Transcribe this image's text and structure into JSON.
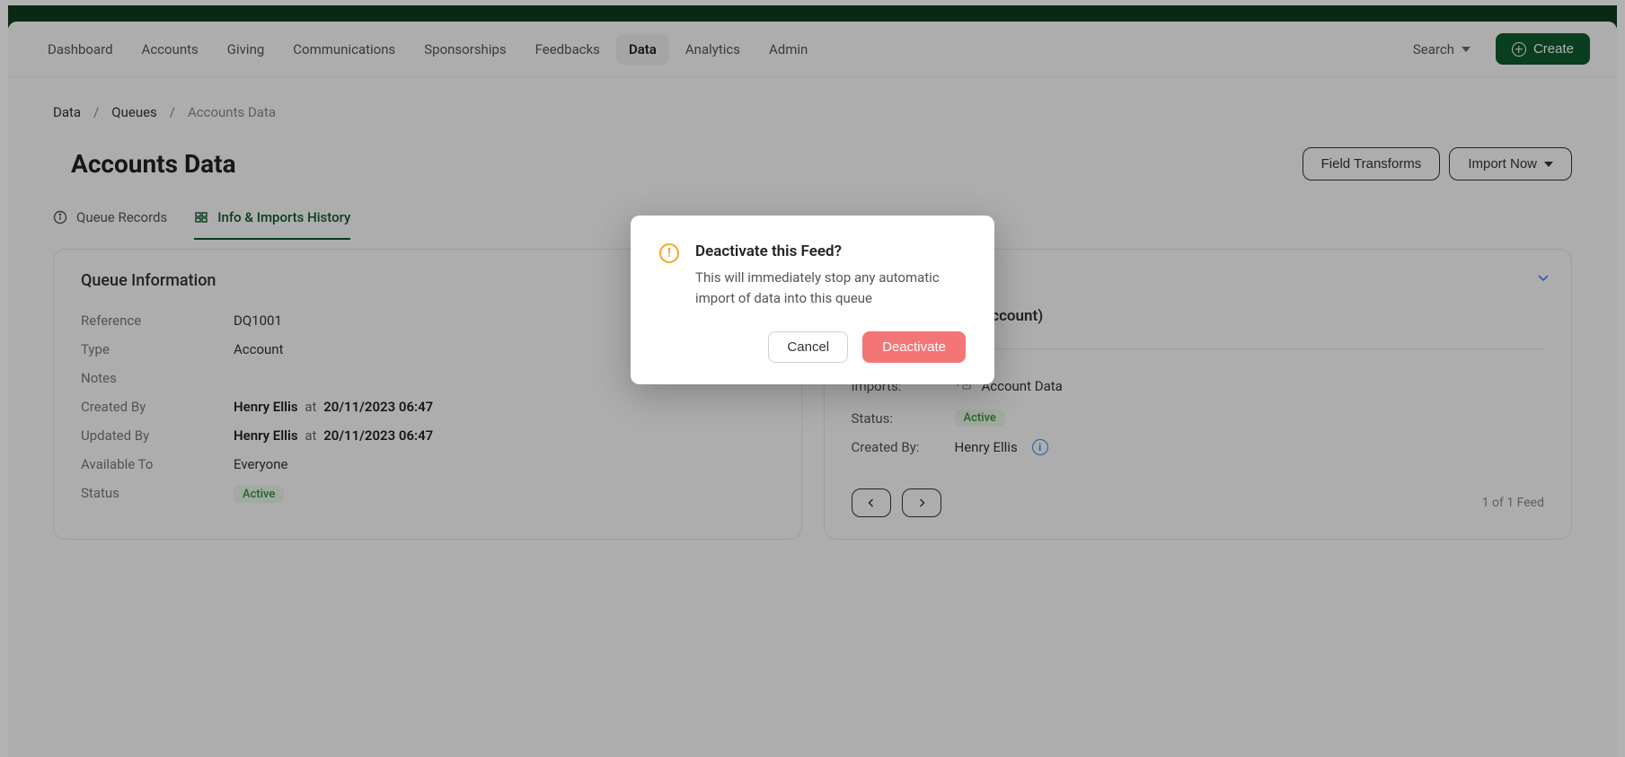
{
  "nav": {
    "items": [
      "Dashboard",
      "Accounts",
      "Giving",
      "Communications",
      "Sponsorships",
      "Feedbacks",
      "Data",
      "Analytics",
      "Admin"
    ],
    "active_index": 6,
    "search_label": "Search",
    "create_label": "Create"
  },
  "breadcrumb": {
    "items": [
      "Data",
      "Queues",
      "Accounts Data"
    ]
  },
  "page": {
    "title": "Accounts Data",
    "field_transforms_label": "Field Transforms",
    "import_now_label": "Import Now"
  },
  "tabs": [
    {
      "label": "Queue Records",
      "active": false
    },
    {
      "label": "Info & Imports History",
      "active": true
    }
  ],
  "queue_info": {
    "panel_title": "Queue Information",
    "reference_label": "Reference",
    "reference_value": "DQ1001",
    "type_label": "Type",
    "type_value": "Account",
    "notes_label": "Notes",
    "created_by_label": "Created By",
    "created_by_user": "Henry Ellis",
    "created_by_at": "at",
    "created_by_ts": "20/11/2023 06:47",
    "updated_by_label": "Updated By",
    "updated_by_user": "Henry Ellis",
    "updated_by_at": "at",
    "updated_by_ts": "20/11/2023 06:47",
    "available_to_label": "Available To",
    "available_to_value": "Everyone",
    "status_label": "Status",
    "status_value": "Active"
  },
  "feed": {
    "name": "CSV Upload (Account)",
    "imports_label": "Imports:",
    "imports_value": "Account Data",
    "status_label": "Status:",
    "status_value": "Active",
    "created_by_label": "Created By:",
    "created_by_value": "Henry Ellis",
    "pager_text": "1 of 1 Feed"
  },
  "modal": {
    "title": "Deactivate this Feed?",
    "body": "This will immediately stop any automatic import of data into this queue",
    "cancel_label": "Cancel",
    "confirm_label": "Deactivate"
  }
}
